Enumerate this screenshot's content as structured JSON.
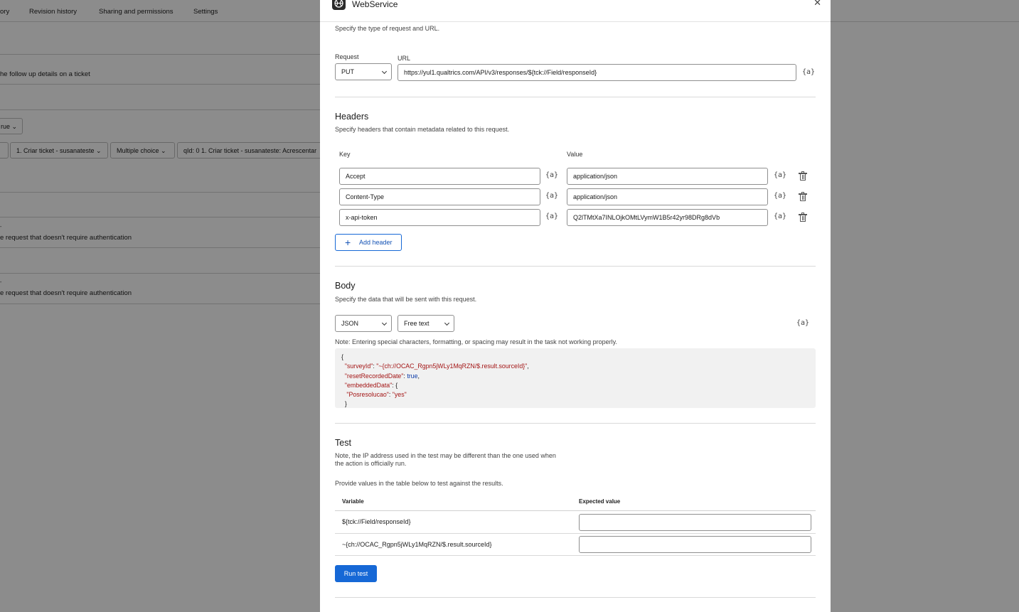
{
  "background": {
    "nav_tabs": [
      "ory",
      "Revision history",
      "Sharing and permissions",
      "Settings"
    ],
    "rows": [
      "he follow up details on a ticket",
      "e request that doesn't require authentication",
      "e request that doesn't require authentication"
    ],
    "small_select": "rue",
    "selects": [
      "1. Criar ticket - susanateste",
      "Multiple choice",
      "qId: 0 1. Criar ticket - susanateste: Acrescentar"
    ],
    "marks": [
      "-",
      "-"
    ]
  },
  "modal": {
    "title": "WebService",
    "close_icon": "close-icon",
    "request_section": {
      "description": "Specify the type of request and URL.",
      "request_label": "Request",
      "request_value": "PUT",
      "url_label": "URL",
      "url_value": "https://yul1.qualtrics.com/API/v3/responses/${tck://Field/responseId}"
    },
    "var_icon_glyph": "{a}",
    "headers_section": {
      "title": "Headers",
      "description": "Specify headers that contain metadata related to this request.",
      "key_label": "Key",
      "value_label": "Value",
      "rows": [
        {
          "key": "Accept",
          "value": "application/json"
        },
        {
          "key": "Content-Type",
          "value": "application/json"
        },
        {
          "key": "x-api-token",
          "value": "Q2lTMtXa7INLOjkOMtLVymW1B5r42yr98DRg8dVb"
        }
      ],
      "add_label": "Add header"
    },
    "body_section": {
      "title": "Body",
      "description": "Specify the data that will be sent with this request.",
      "format_value": "JSON",
      "mode_value": "Free text",
      "note": "Note: Entering special characters, formatting, or spacing may result in the task not working properly.",
      "code": {
        "open": "{",
        "l1_key": "\"surveyId\"",
        "l1_val": "\"~{ch://OCAC_Rgpn5jWLy1MqRZN/$.result.sourceId}\"",
        "l2_key": "\"resetRecordedDate\"",
        "l2_val": "true",
        "l3_key": "\"embeddedData\"",
        "l3_val": "{",
        "l4_key": "\"Posresolucao\"",
        "l4_val": "\"yes\"",
        "l5": "}"
      }
    },
    "test_section": {
      "title": "Test",
      "note_line1": "Note, the IP address used in the test may be different than the one used when",
      "note_line2": "the action is officially run.",
      "instructions": "Provide values in the table below to test against the results.",
      "col_variable": "Variable",
      "col_expected": "Expected value",
      "rows": [
        {
          "variable": "${tck://Field/responseId}",
          "expected": ""
        },
        {
          "variable": "~{ch://OCAC_Rgpn5jWLy1MqRZN/$.result.sourceId}",
          "expected": ""
        }
      ],
      "run_label": "Run test"
    }
  }
}
